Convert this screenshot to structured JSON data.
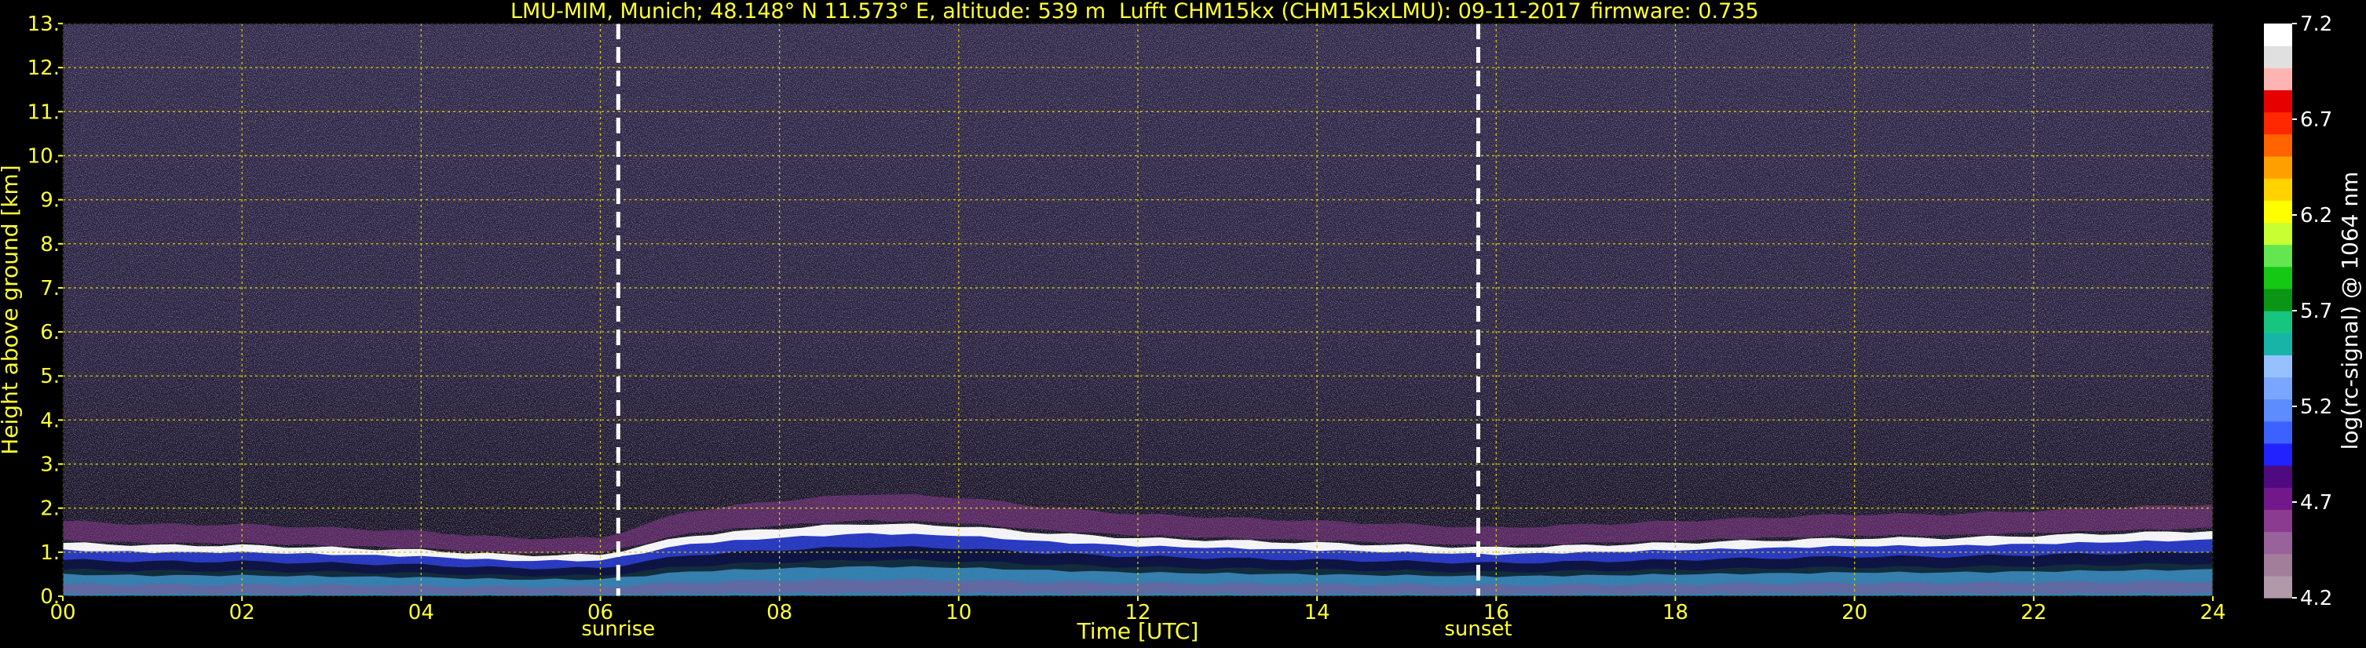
{
  "header": {
    "station": "LMU-MIM, Munich; 48.148° N 11.573° E, altitude: 539 m",
    "instrument": "Lufft CHM15kx (CHM15kxLMU): 09-11-2017",
    "firmware": "firmware: 0.735"
  },
  "colors": {
    "text": "#ffff33",
    "colorbar_text": "#ffffff",
    "grid": "#d4c800",
    "background": "#000000",
    "marker_line": "#ffffff"
  },
  "chart_data": {
    "type": "heatmap",
    "xlabel": "Time [UTC]",
    "ylabel": "Height above ground [km]",
    "xlim": [
      0,
      24
    ],
    "ylim": [
      0,
      13
    ],
    "x_ticks": [
      0,
      2,
      4,
      6,
      8,
      10,
      12,
      14,
      16,
      18,
      20,
      22,
      24
    ],
    "x_tick_labels": [
      "00",
      "02",
      "04",
      "06",
      "08",
      "10",
      "12",
      "14",
      "16",
      "18",
      "20",
      "22",
      "24"
    ],
    "y_ticks": [
      0,
      1,
      2,
      3,
      4,
      5,
      6,
      7,
      8,
      9,
      10,
      11,
      12,
      13
    ],
    "y_tick_labels": [
      "0.",
      "1.",
      "2.",
      "3.",
      "4.",
      "5.",
      "6.",
      "7.",
      "8.",
      "9.",
      "10.",
      "11.",
      "12.",
      "13."
    ],
    "grid": true,
    "markers": [
      {
        "label": "sunrise",
        "time": 6.2
      },
      {
        "label": "sunset",
        "time": 15.8
      }
    ],
    "boundary_layer_top_km": [
      [
        0,
        1.1
      ],
      [
        1,
        1.05
      ],
      [
        2,
        1.05
      ],
      [
        3,
        1.0
      ],
      [
        4,
        0.95
      ],
      [
        5,
        0.85
      ],
      [
        6,
        0.85
      ],
      [
        6.5,
        1.05
      ],
      [
        7,
        1.25
      ],
      [
        8,
        1.4
      ],
      [
        9,
        1.5
      ],
      [
        10,
        1.45
      ],
      [
        11,
        1.3
      ],
      [
        12,
        1.2
      ],
      [
        13,
        1.15
      ],
      [
        14,
        1.1
      ],
      [
        15,
        1.05
      ],
      [
        16,
        1.0
      ],
      [
        17,
        1.05
      ],
      [
        18,
        1.1
      ],
      [
        19,
        1.15
      ],
      [
        20,
        1.2
      ],
      [
        21,
        1.2
      ],
      [
        22,
        1.25
      ],
      [
        23,
        1.3
      ],
      [
        24,
        1.35
      ]
    ],
    "colorbar": {
      "label": "log(rc-signal) @ 1064 nm",
      "min": 4.2,
      "max": 7.2,
      "ticks": [
        4.2,
        4.7,
        5.2,
        5.7,
        6.2,
        6.7,
        7.2
      ],
      "tick_labels": [
        "4.2",
        "4.7",
        "5.2",
        "5.7",
        "6.2",
        "6.7",
        "7.2"
      ],
      "colors": [
        "#b09aaa",
        "#a27e9a",
        "#98639a",
        "#8b3c90",
        "#73188a",
        "#500a80",
        "#2222ff",
        "#3b62ff",
        "#5d8cff",
        "#7aa6ff",
        "#96c0ff",
        "#18b4a8",
        "#17c480",
        "#0a9614",
        "#14c814",
        "#64e650",
        "#c8ff32",
        "#ffff00",
        "#ffd200",
        "#ffa000",
        "#ff6400",
        "#ff2800",
        "#e60000",
        "#ffb4b4",
        "#e0e0e0",
        "#ffffff"
      ]
    }
  }
}
